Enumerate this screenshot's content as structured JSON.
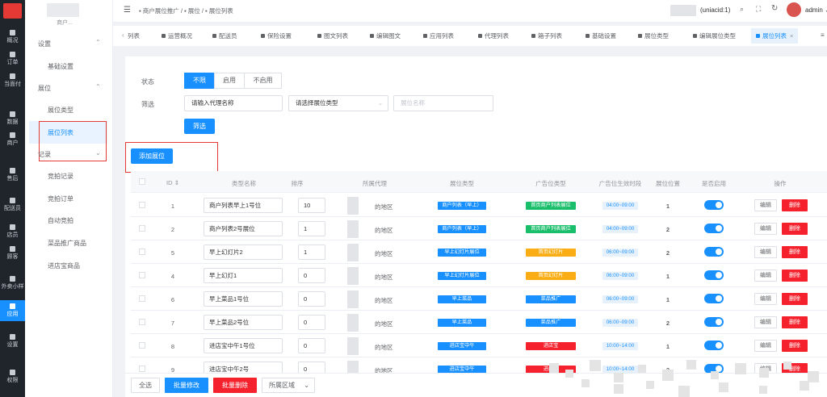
{
  "rail": {
    "items": [
      "概况",
      "订单",
      "当面付",
      "数据",
      "商户",
      "售后",
      "配送员",
      "店员",
      "顾客",
      "外卖小样",
      "应用",
      "设置",
      "权限"
    ]
  },
  "sidebar": {
    "shop_name": "商户...",
    "section1": "设置",
    "item_basic": "基础设置",
    "section2": "展位",
    "item_type": "展位类型",
    "item_list": "展位列表",
    "section3": "记录",
    "items_more": [
      "竞拍记录",
      "竞拍订单",
      "自动竞拍",
      "菜品推广商品",
      "进店宝商品"
    ]
  },
  "header": {
    "breadcrumb": [
      "商户展位推广",
      "展位",
      "展位列表"
    ],
    "user": "(uniacid:1)",
    "admin": "admin"
  },
  "tabs": [
    "列表",
    "运营概况",
    "配送员",
    "保险设置",
    "图文列表",
    "编辑图文",
    "应用列表",
    "代理列表",
    "箱子列表",
    "基础设置",
    "展位类型",
    "编辑展位类型",
    "展位列表"
  ],
  "filters": {
    "status_label": "状态",
    "status_options": [
      "不限",
      "启用",
      "不启用"
    ],
    "filter_label": "筛选",
    "agent_placeholder": "请输入代理名称",
    "type_placeholder": "请选择展位类型",
    "name_placeholder": "展位名称",
    "search_btn": "筛选"
  },
  "add_btn": "添加展位",
  "table": {
    "headers": [
      "ID",
      "类型名称",
      "排序",
      "所属代理",
      "展位类型",
      "广告位类型",
      "广告位生效时段",
      "展位位置",
      "是否启用",
      "操作"
    ],
    "rows": [
      {
        "id": "1",
        "name": "商户列表早上1号位",
        "sort": "10",
        "region": "的地区",
        "btype": "商户列表（早上）",
        "btype_color": "#1890ff",
        "atype": "首页商户列表展位",
        "atype_color": "#19be6b",
        "time": "04:00~09:00",
        "pos": "1"
      },
      {
        "id": "2",
        "name": "商户列表2号展位",
        "sort": "1",
        "region": "的地区",
        "btype": "商户列表（早上）",
        "btype_color": "#1890ff",
        "atype": "首页商户列表展位",
        "atype_color": "#19be6b",
        "time": "04:00~09:00",
        "pos": "2"
      },
      {
        "id": "5",
        "name": "早上幻灯片2",
        "sort": "1",
        "region": "的地区",
        "btype": "早上幻灯片展位",
        "btype_color": "#1890ff",
        "atype": "首页幻灯片",
        "atype_color": "#faad14",
        "time": "06:00~09:00",
        "pos": "2"
      },
      {
        "id": "4",
        "name": "早上幻灯1",
        "sort": "0",
        "region": "的地区",
        "btype": "早上幻灯片展位",
        "btype_color": "#1890ff",
        "atype": "首页幻灯片",
        "atype_color": "#faad14",
        "time": "06:00~09:00",
        "pos": "1"
      },
      {
        "id": "6",
        "name": "早上菜品1号位",
        "sort": "0",
        "region": "的地区",
        "btype": "早上菜品",
        "btype_color": "#1890ff",
        "atype": "菜品推广",
        "atype_color": "#1890ff",
        "time": "06:00~09:00",
        "pos": "1"
      },
      {
        "id": "7",
        "name": "早上菜品2号位",
        "sort": "0",
        "region": "的地区",
        "btype": "早上菜品",
        "btype_color": "#1890ff",
        "atype": "菜品推广",
        "atype_color": "#1890ff",
        "time": "06:00~09:00",
        "pos": "2"
      },
      {
        "id": "8",
        "name": "进店宝中午1号位",
        "sort": "0",
        "region": "的地区",
        "btype": "进店宝中午",
        "btype_color": "#1890ff",
        "atype": "进店宝",
        "atype_color": "#f5222d",
        "time": "10:00~14:00",
        "pos": "1"
      },
      {
        "id": "9",
        "name": "进店宝中午2号",
        "sort": "0",
        "region": "的地区",
        "btype": "进店宝中午",
        "btype_color": "#1890ff",
        "atype": "进店宝",
        "atype_color": "#f5222d",
        "time": "10:00~14:00",
        "pos": "2"
      }
    ],
    "edit": "编辑",
    "delete": "删除"
  },
  "footer": {
    "select_all": "全选",
    "batch_edit": "批量修改",
    "batch_delete": "批量删除",
    "region_select": "所属区域"
  }
}
